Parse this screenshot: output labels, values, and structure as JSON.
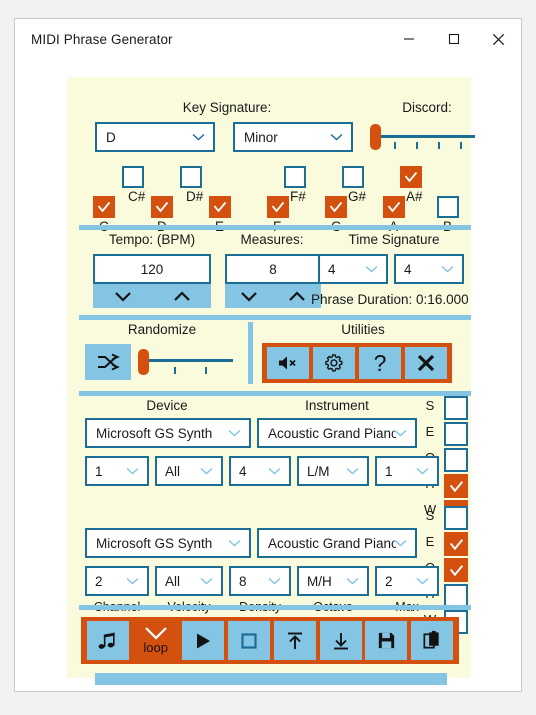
{
  "window": {
    "title": "MIDI Phrase Generator",
    "controls": [
      {
        "name": "minimize",
        "glyph": "minimize-icon"
      },
      {
        "name": "maximize",
        "glyph": "maximize-icon"
      },
      {
        "name": "close",
        "glyph": "close-icon"
      }
    ]
  },
  "colors": {
    "panel_bg": "#fafbdd",
    "accent_blue": "#1b6e96",
    "light_blue": "#84c5e3",
    "orange": "#d4500f"
  },
  "key_section": {
    "key_signature_label": "Key Signature:",
    "discord_label": "Discord:",
    "root_value": "D",
    "mode_value": "Minor",
    "discord_value": 0,
    "discord_ticks": 4
  },
  "notes": {
    "sharps": [
      {
        "label": "C#",
        "checked": false
      },
      {
        "label": "D#",
        "checked": false
      },
      {
        "label": "F#",
        "checked": false
      },
      {
        "label": "G#",
        "checked": false
      },
      {
        "label": "A#",
        "checked": true
      }
    ],
    "naturals": [
      {
        "label": "C",
        "checked": true
      },
      {
        "label": "D",
        "checked": true
      },
      {
        "label": "E",
        "checked": true
      },
      {
        "label": "F",
        "checked": true
      },
      {
        "label": "G",
        "checked": true
      },
      {
        "label": "A",
        "checked": true
      },
      {
        "label": "B",
        "checked": false
      }
    ]
  },
  "tempo_section": {
    "tempo_label": "Tempo: (BPM)",
    "tempo_value": "120",
    "measures_label": "Measures:",
    "measures_value": "8",
    "time_signature_label": "Time Signature",
    "time_sig_numerator": "4",
    "time_sig_denominator": "4",
    "phrase_duration": "Phrase Duration: 0:16.000"
  },
  "randomize_section": {
    "label": "Randomize",
    "shuffle_icon": "shuffle-icon",
    "slider_value": 0,
    "slider_ticks": 2
  },
  "utilities_section": {
    "label": "Utilities",
    "buttons": [
      {
        "name": "mute-button",
        "icon": "speaker-mute-icon"
      },
      {
        "name": "settings-button",
        "icon": "gear-icon"
      },
      {
        "name": "help-button",
        "icon": "question-mark-icon"
      },
      {
        "name": "close-button",
        "icon": "close-x-icon"
      }
    ]
  },
  "tracks_section": {
    "device_label": "Device",
    "instrument_label": "Instrument",
    "column_labels": [
      "Channel",
      "Velocity",
      "Density",
      "Octave",
      "Max"
    ],
    "note_length_labels": [
      "S",
      "E",
      "Q",
      "H",
      "W"
    ],
    "tracks": [
      {
        "device": "Microsoft GS Synth",
        "instrument": "Acoustic Grand Piano",
        "channel": "1",
        "velocity": "All",
        "density": "4",
        "octave": "L/M",
        "max": "1",
        "lengths": [
          false,
          false,
          false,
          true,
          true
        ]
      },
      {
        "device": "Microsoft GS Synth",
        "instrument": "Acoustic Grand Piano",
        "channel": "2",
        "velocity": "All",
        "density": "8",
        "octave": "M/H",
        "max": "2",
        "lengths": [
          false,
          true,
          true,
          false,
          false
        ]
      }
    ]
  },
  "transport": {
    "loop_label": "loop",
    "loop_checked": true,
    "buttons": [
      {
        "name": "notes-button",
        "icon": "music-notes-icon"
      },
      {
        "name": "loop-toggle",
        "icon": "check-icon"
      },
      {
        "name": "play-button",
        "icon": "play-icon"
      },
      {
        "name": "stop-button",
        "icon": "stop-icon"
      },
      {
        "name": "export-button",
        "icon": "upload-icon"
      },
      {
        "name": "import-button",
        "icon": "download-icon"
      },
      {
        "name": "save-button",
        "icon": "floppy-disk-icon"
      },
      {
        "name": "copy-button",
        "icon": "clipboard-icon"
      }
    ]
  },
  "progress": {
    "value": 100
  }
}
